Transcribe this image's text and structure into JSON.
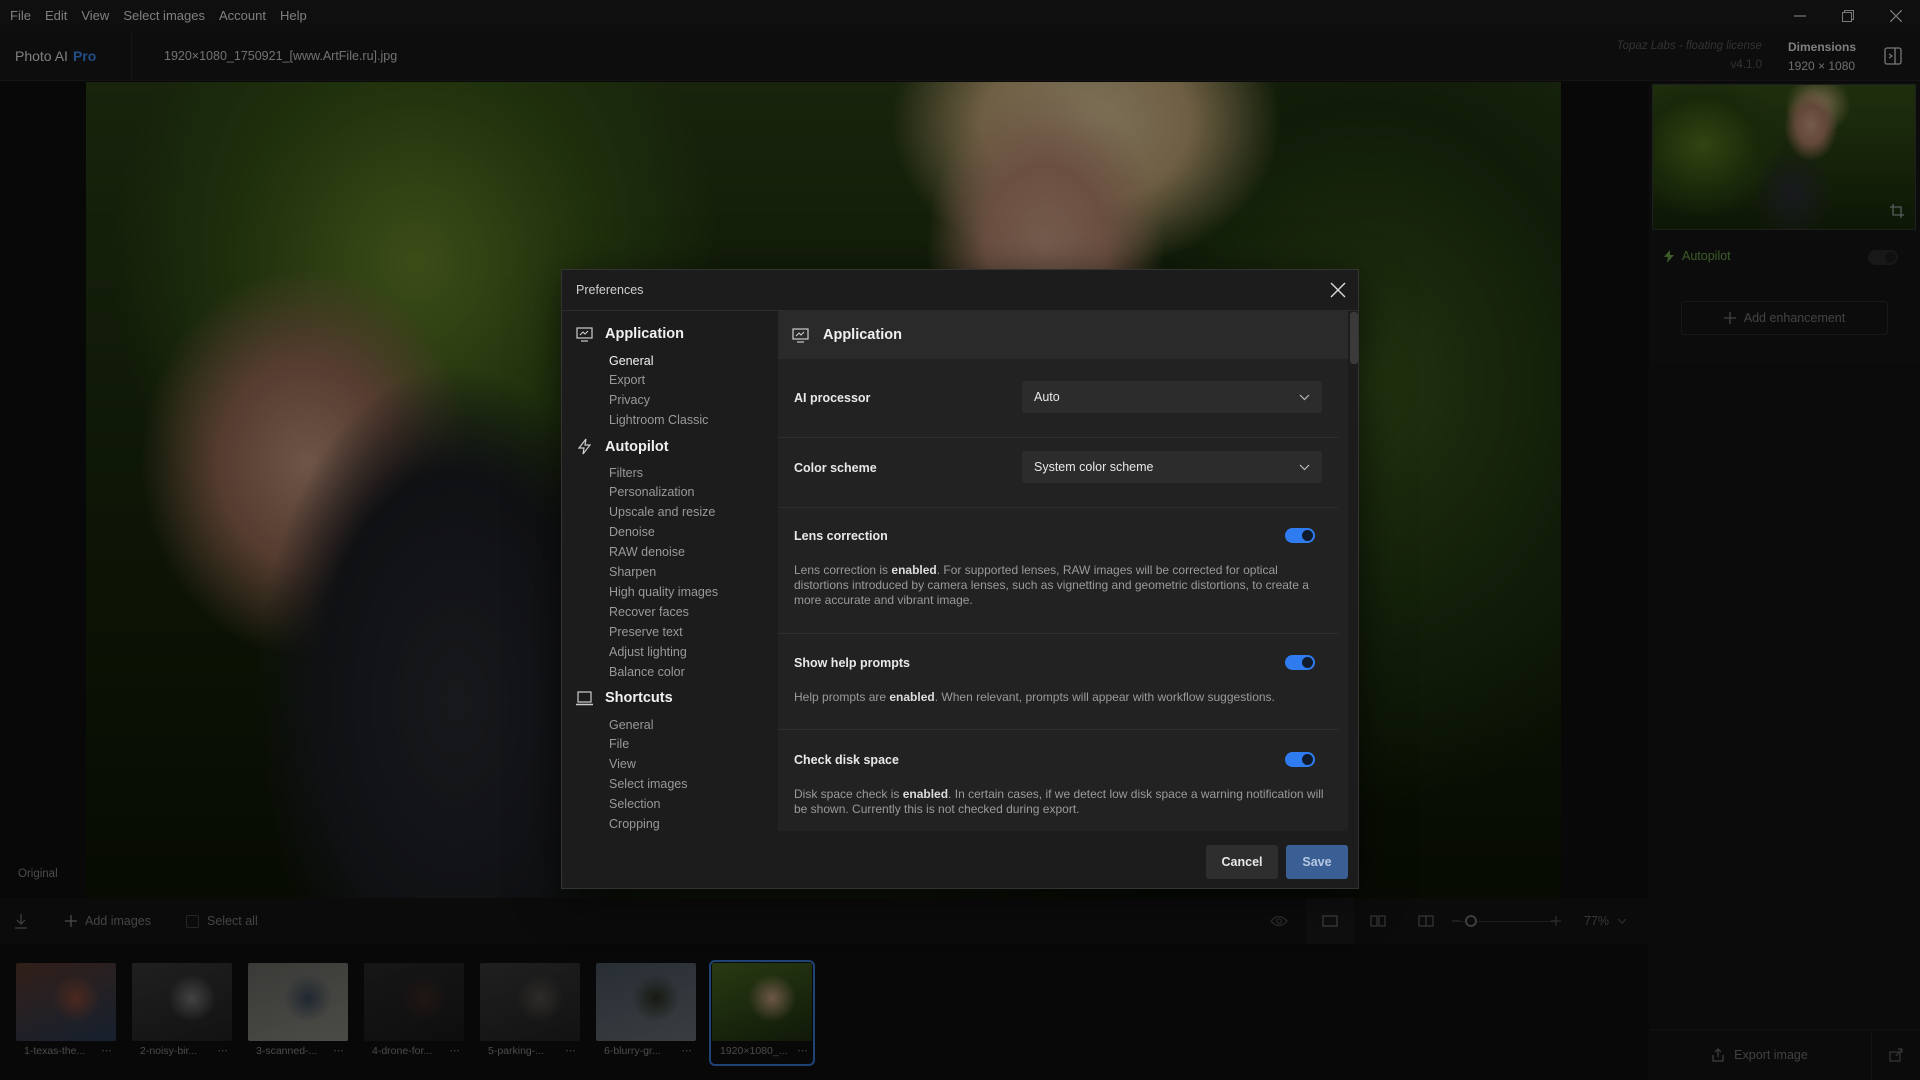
{
  "menubar": {
    "items": [
      "File",
      "Edit",
      "View",
      "Select images",
      "Account",
      "Help"
    ]
  },
  "header": {
    "app_name": "Photo AI",
    "app_tier": "Pro",
    "file_name": "1920×1080_1750921_[www.ArtFile.ru].jpg",
    "license": "Topaz Labs - floating license",
    "version": "v4.1.0",
    "dimensions_title": "Dimensions",
    "dimensions_value": "1920 × 1080"
  },
  "canvas": {
    "view_label": "Original"
  },
  "right_panel": {
    "autopilot_label": "Autopilot",
    "add_enhancement_label": "Add enhancement",
    "export_label": "Export image"
  },
  "bottombar": {
    "add_images_label": "Add images",
    "select_all_label": "Select all",
    "zoom": "77%"
  },
  "filmstrip": [
    {
      "name": "1-texas-the...",
      "colors": [
        "#5a3a2e",
        "#8a4a38",
        "#2a3b55"
      ]
    },
    {
      "name": "2-noisy-bir...",
      "colors": [
        "#3a3a3a",
        "#7a7a7a",
        "#222222"
      ]
    },
    {
      "name": "3-scanned-...",
      "colors": [
        "#6a6a66",
        "#3a4a5a",
        "#8a8a80"
      ]
    },
    {
      "name": "4-drone-for...",
      "colors": [
        "#2a2a2a",
        "#3a2a22",
        "#1a1a1a"
      ]
    },
    {
      "name": "5-parking-...",
      "colors": [
        "#3a3a3a",
        "#55504a",
        "#222222"
      ]
    },
    {
      "name": "6-blurry-gr...",
      "colors": [
        "#4a5560",
        "#2a3020",
        "#6a7078"
      ]
    },
    {
      "name": "1920×1080_...",
      "colors": [
        "#4a6a22",
        "#c8a080",
        "#1e2e10"
      ]
    }
  ],
  "dialog": {
    "title": "Preferences",
    "nav": {
      "groups": [
        {
          "label": "Application",
          "icon": "application-icon",
          "items": [
            "General",
            "Export",
            "Privacy",
            "Lightroom Classic"
          ]
        },
        {
          "label": "Autopilot",
          "icon": "autopilot-icon",
          "items": [
            "Filters",
            "Personalization",
            "Upscale and resize",
            "Denoise",
            "RAW denoise",
            "Sharpen",
            "High quality images",
            "Recover faces",
            "Preserve text",
            "Adjust lighting",
            "Balance color"
          ]
        },
        {
          "label": "Shortcuts",
          "icon": "shortcuts-icon",
          "items": [
            "General",
            "File",
            "View",
            "Select images",
            "Selection",
            "Cropping"
          ]
        }
      ]
    },
    "content": {
      "section_title": "Application",
      "ai_processor": {
        "label": "AI processor",
        "value": "Auto"
      },
      "color_scheme": {
        "label": "Color scheme",
        "value": "System color scheme"
      },
      "lens_correction": {
        "label": "Lens correction",
        "enabled": true,
        "desc_pre": "Lens correction is ",
        "desc_bold": "enabled",
        "desc_post": ". For supported lenses, RAW images will be corrected for optical distortions introduced by camera lenses, such as vignetting and geometric distortions, to create a more accurate and vibrant image."
      },
      "help_prompts": {
        "label": "Show help prompts",
        "enabled": true,
        "desc_pre": "Help prompts are ",
        "desc_bold": "enabled",
        "desc_post": ". When relevant, prompts will appear with workflow suggestions."
      },
      "disk_space": {
        "label": "Check disk space",
        "enabled": true,
        "desc_pre": "Disk space check is ",
        "desc_bold": "enabled",
        "desc_post": ". In certain cases, if we detect low disk space a warning notification will be shown. Currently this is not checked during export."
      }
    },
    "cancel_label": "Cancel",
    "save_label": "Save"
  },
  "colors": {
    "accent": "#2f7cf0",
    "brand_pro": "#3d8ff5",
    "autopilot_green": "#6da84a",
    "save_bg": "#3a5f95"
  }
}
